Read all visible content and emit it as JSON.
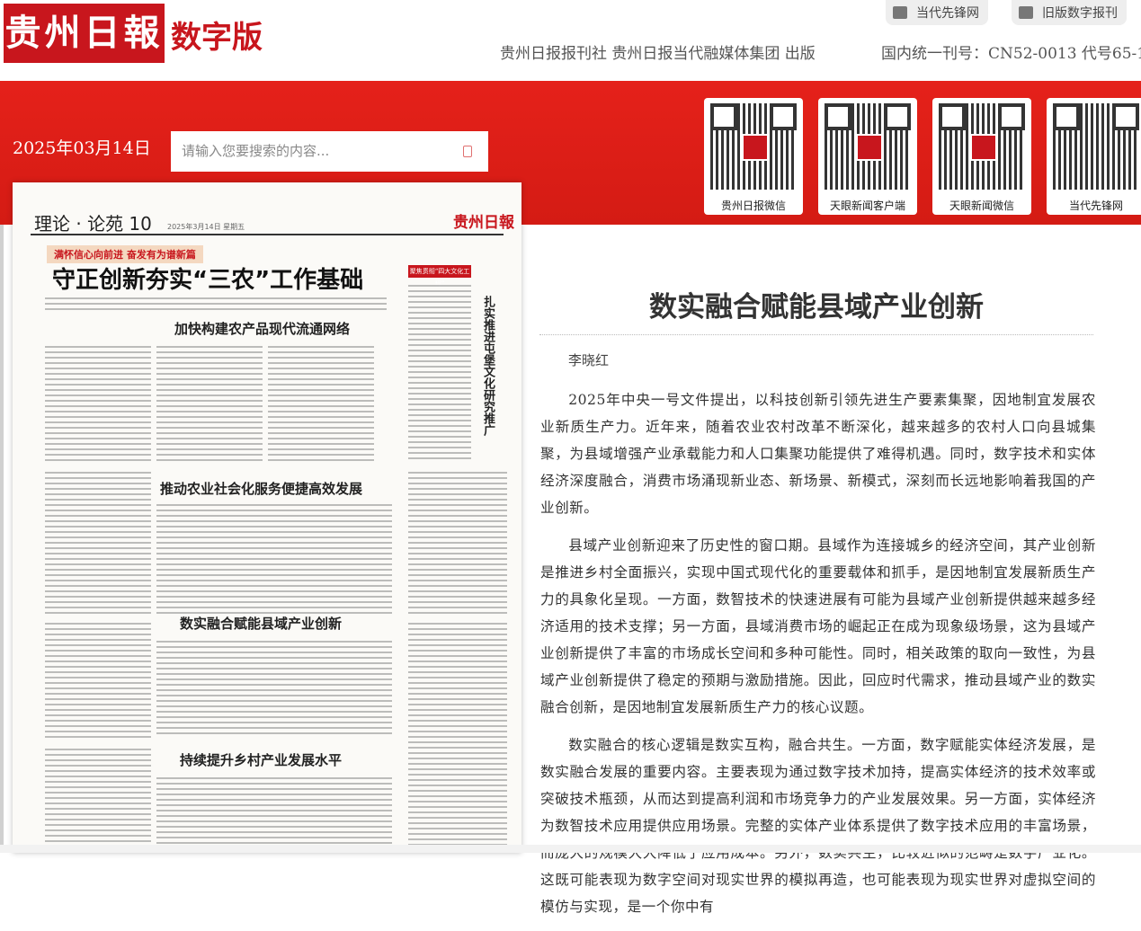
{
  "header": {
    "logo_text": "贵州日報",
    "logo_sub": "数字版",
    "links": [
      {
        "label": "当代先锋网",
        "icon": "grid-icon"
      },
      {
        "label": "旧版数字报刊",
        "icon": "grid-icon"
      }
    ],
    "publisher": "贵州日报报刊社 贵州日报当代融媒体集团 出版",
    "issn": "国内统一刊号：CN52-0013 代号65-1"
  },
  "toolbar": {
    "date": "2025年03月14日",
    "search_placeholder": "请输入您要搜索的内容..."
  },
  "qr_codes": [
    {
      "label": "贵州日报微信"
    },
    {
      "label": "天眼新闻客户端"
    },
    {
      "label": "天眼新闻微信"
    },
    {
      "label": "当代先锋网"
    }
  ],
  "paper": {
    "section": "理论 · 论苑 10",
    "meta": "2025年3月14日  星期五",
    "logo": "贵州日報",
    "banner": "满怀信心向前进 奋发有为谱新篇",
    "headline": "守正创新夯实“三农”工作基础",
    "subheads": [
      "加快构建农产品现代流通网络",
      "推动农业社会化服务便捷高效发展",
      "数实融合赋能县域产业创新",
      "持续提升乡村产业发展水平"
    ],
    "side_title": "扎实推进屯堡文化研究推广",
    "side_box": "聚焦贯彻“四大文化工程”"
  },
  "article": {
    "title": "数实融合赋能县域产业创新",
    "author": "李晓红",
    "paragraphs": [
      "2025年中央一号文件提出，以科技创新引领先进生产要素集聚，因地制宜发展农业新质生产力。近年来，随着农业农村改革不断深化，越来越多的农村人口向县城集聚，为县域增强产业承载能力和人口集聚功能提供了难得机遇。同时，数字技术和实体经济深度融合，消费市场涌现新业态、新场景、新模式，深刻而长远地影响着我国的产业创新。",
      "县域产业创新迎来了历史性的窗口期。县域作为连接城乡的经济空间，其产业创新是推进乡村全面振兴，实现中国式现代化的重要载体和抓手，是因地制宜发展新质生产力的具象化呈现。一方面，数智技术的快速进展有可能为县域产业创新提供越来越多经济适用的技术支撑；另一方面，县域消费市场的崛起正在成为现象级场景，这为县域产业创新提供了丰富的市场成长空间和多种可能性。同时，相关政策的取向一致性，为县域产业创新提供了稳定的预期与激励措施。因此，回应时代需求，推动县域产业的数实融合创新，是因地制宜发展新质生产力的核心议题。",
      "数实融合的核心逻辑是数实互构，融合共生。一方面，数字赋能实体经济发展，是数实融合发展的重要内容。主要表现为通过数字技术加持，提高实体经济的技术效率或突破技术瓶颈，从而达到提高利润和市场竞争力的产业发展效果。另一方面，实体经济为数智技术应用提供应用场景。完整的实体产业体系提供了数字技术应用的丰富场景，而庞大的规模大大降低了应用成本。另外，数实共生，比较近似的范畴是数字产业化。这既可能表现为数字空间对现实世界的模拟再造，也可能表现为现实世界对虚拟空间的模仿与实现，是一个你中有"
    ]
  }
}
